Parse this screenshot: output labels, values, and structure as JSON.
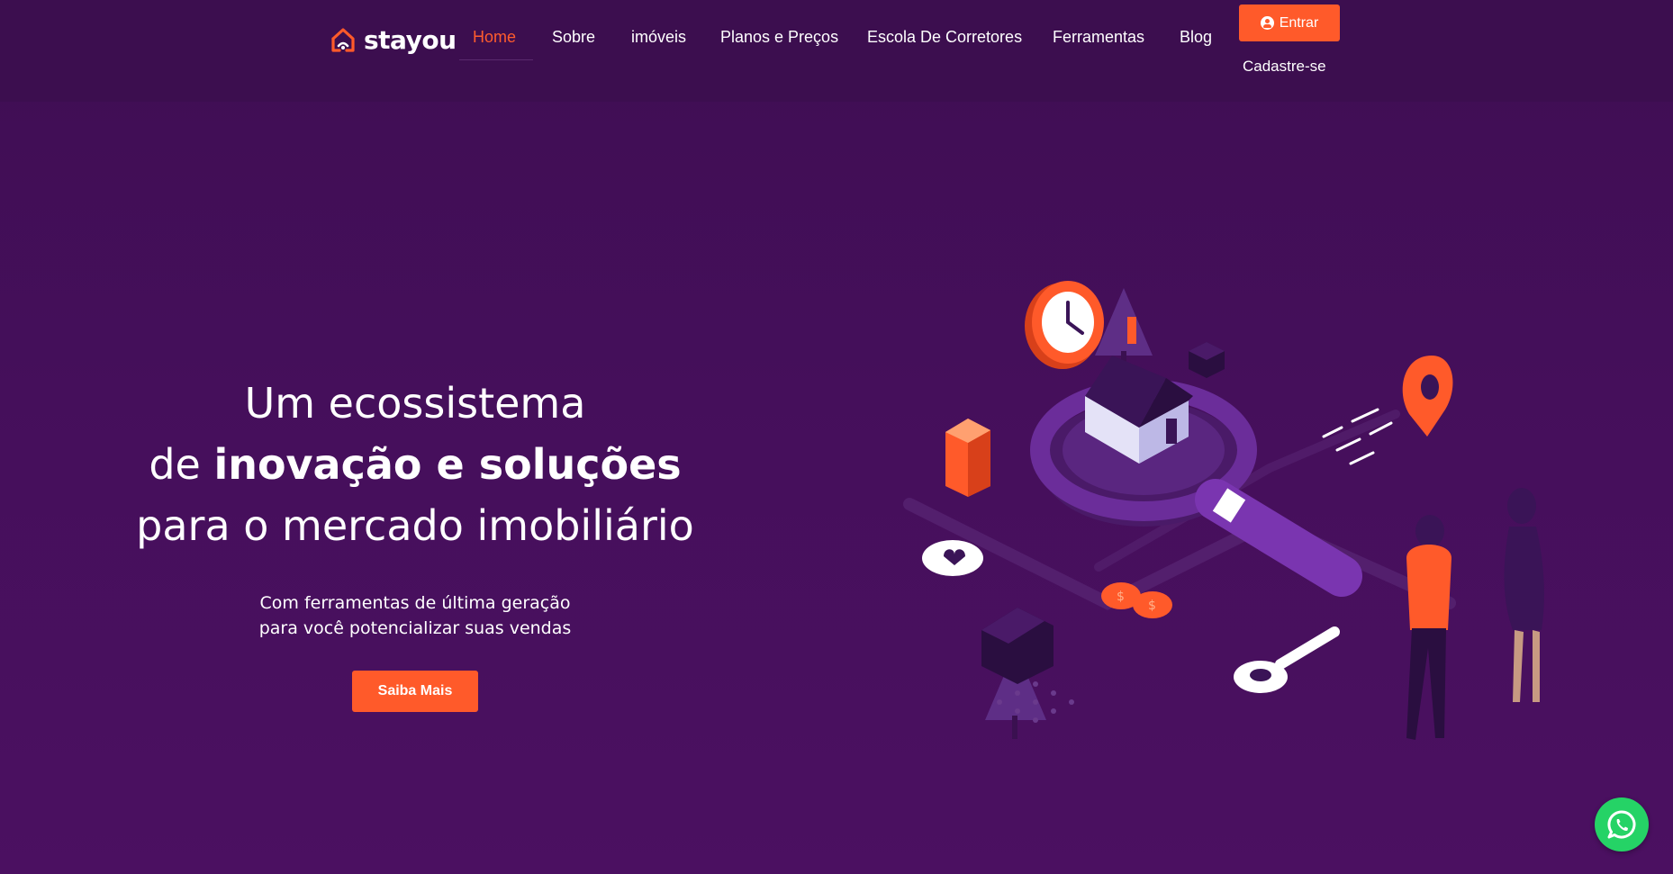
{
  "brand": {
    "name": "stayou",
    "accent": "#ff5a2a",
    "background": "#450f5b"
  },
  "nav": {
    "items": [
      {
        "label": "Home",
        "active": true
      },
      {
        "label": "Sobre"
      },
      {
        "label": "imóveis"
      },
      {
        "label": "Planos e Preços"
      },
      {
        "label": "Escola De Corretores"
      },
      {
        "label": "Ferramentas"
      },
      {
        "label": "Blog"
      }
    ],
    "login": {
      "label": "Entrar",
      "icon": "user-circle-icon"
    },
    "signup": {
      "label": "Cadastre-se"
    }
  },
  "hero": {
    "line1": "Um ecossistema",
    "line2_prefix": "de ",
    "line2_bold": "inovação e soluções",
    "line3": "para o mercado imobiliário",
    "sub_line1": "Com ferramentas de última geração",
    "sub_line2": "para você potencializar suas vendas",
    "cta": "Saiba Mais"
  },
  "floating": {
    "whatsapp_icon": "whatsapp-icon"
  }
}
